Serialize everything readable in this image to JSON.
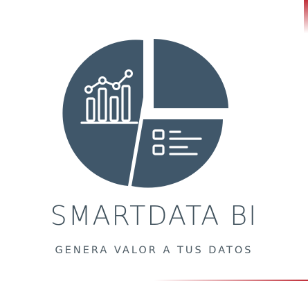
{
  "brand": {
    "name": "SMARTDATA BI",
    "tagline": "GENERA VALOR A TUS DATOS"
  },
  "logo": {
    "icons": [
      "pie-chart-icon",
      "bar-chart-icon",
      "line-trend-icon",
      "checklist-icon"
    ]
  },
  "colors": {
    "primary": "#40576a",
    "text": "#40515c",
    "icon_stroke": "#ffffff",
    "accent": "#c0303a"
  }
}
